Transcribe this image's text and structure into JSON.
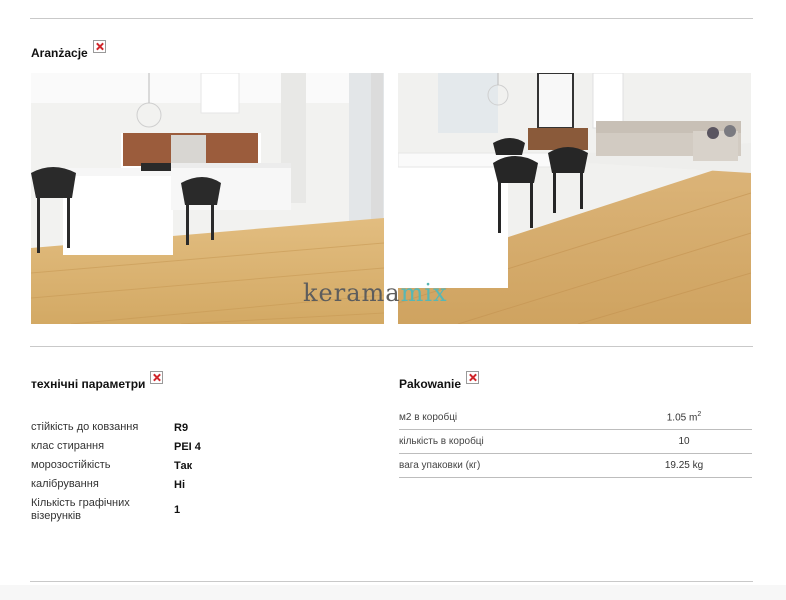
{
  "arrangements": {
    "title": "Aranżacje",
    "icon": "broken-image-icon"
  },
  "photos": [
    {
      "name": "kitchen-interior-photo"
    },
    {
      "name": "dining-living-interior-photo"
    }
  ],
  "watermark": {
    "part1": "kerama",
    "part2": "mix"
  },
  "tech": {
    "title": "технічні параметри",
    "icon": "broken-image-icon",
    "rows": [
      {
        "label": "стійкість до ковзання",
        "value": "R9"
      },
      {
        "label": "клас стирання",
        "value": "PEI 4"
      },
      {
        "label": "морозостійкість",
        "value": "Так"
      },
      {
        "label": "калібрування",
        "value": "Ні"
      },
      {
        "label": "Кількість графічних візерунків",
        "value": "1"
      }
    ]
  },
  "packing": {
    "title": "Pakowanie",
    "icon": "broken-image-icon",
    "rows": [
      {
        "label": "м2 в коробці",
        "value": "1.05 m",
        "sup": "2"
      },
      {
        "label": "кількість в коробці",
        "value": "10",
        "sup": ""
      },
      {
        "label": "вага упаковки (кг)",
        "value": "19.25 kg",
        "sup": ""
      }
    ]
  },
  "colors": {
    "wood_floor": "#d9b474",
    "wall_white": "#f4f4f2",
    "brick": "#9b5c3c",
    "accent_teal": "#58b7b4",
    "divider": "#c9c9c9"
  }
}
